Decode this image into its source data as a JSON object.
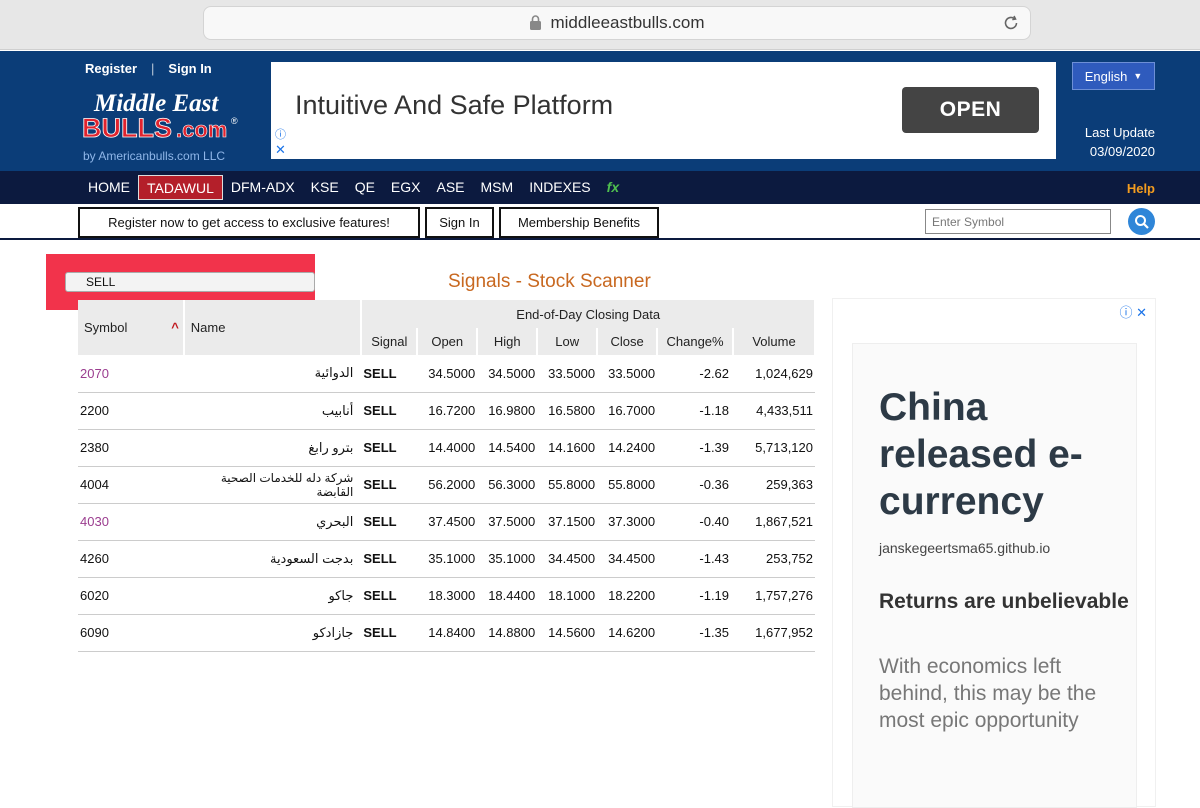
{
  "browser": {
    "url": "middleeastbulls.com"
  },
  "header": {
    "register": "Register",
    "sign_in": "Sign In",
    "logo_line1": "Middle East",
    "logo_line2": "BULLS.com",
    "logo_tagline": "by Americanbulls.com LLC",
    "language": "English",
    "last_update_label": "Last Update",
    "last_update_date": "03/09/2020"
  },
  "ad_banner": {
    "text": "Intuitive And Safe Platform",
    "button": "OPEN"
  },
  "nav": {
    "items": [
      "HOME",
      "TADAWUL",
      "DFM-ADX",
      "KSE",
      "QE",
      "EGX",
      "ASE",
      "MSM",
      "INDEXES",
      "fx"
    ],
    "active": "TADAWUL",
    "help": "Help"
  },
  "subbar": {
    "register_promo": "Register now to get access to exclusive features!",
    "sign_in": "Sign In",
    "membership": "Membership Benefits",
    "symbol_placeholder": "Enter Symbol"
  },
  "filter": {
    "selected": "SELL"
  },
  "page_title": "Signals - Stock Scanner",
  "table": {
    "group_header": "End-of-Day Closing Data",
    "headers": {
      "symbol": "Symbol",
      "name": "Name",
      "signal": "Signal",
      "open": "Open",
      "high": "High",
      "low": "Low",
      "close": "Close",
      "change": "Change%",
      "volume": "Volume"
    },
    "rows": [
      {
        "symbol": "2070",
        "name": "الدوائية",
        "signal": "SELL",
        "open": "34.5000",
        "high": "34.5000",
        "low": "33.5000",
        "close": "33.5000",
        "change": "-2.62",
        "volume": "1,024,629"
      },
      {
        "symbol": "2200",
        "name": "أنابيب",
        "signal": "SELL",
        "open": "16.7200",
        "high": "16.9800",
        "low": "16.5800",
        "close": "16.7000",
        "change": "-1.18",
        "volume": "4,433,511"
      },
      {
        "symbol": "2380",
        "name": "بترو رابغ",
        "signal": "SELL",
        "open": "14.4000",
        "high": "14.5400",
        "low": "14.1600",
        "close": "14.2400",
        "change": "-1.39",
        "volume": "5,713,120"
      },
      {
        "symbol": "4004",
        "name": "شركة دله للخدمات الصحية القابضة",
        "signal": "SELL",
        "open": "56.2000",
        "high": "56.3000",
        "low": "55.8000",
        "close": "55.8000",
        "change": "-0.36",
        "volume": "259,363"
      },
      {
        "symbol": "4030",
        "name": "البحري",
        "signal": "SELL",
        "open": "37.4500",
        "high": "37.5000",
        "low": "37.1500",
        "close": "37.3000",
        "change": "-0.40",
        "volume": "1,867,521"
      },
      {
        "symbol": "4260",
        "name": "بدجت السعودية",
        "signal": "SELL",
        "open": "35.1000",
        "high": "35.1000",
        "low": "34.4500",
        "close": "34.4500",
        "change": "-1.43",
        "volume": "253,752"
      },
      {
        "symbol": "6020",
        "name": "جاكو",
        "signal": "SELL",
        "open": "18.3000",
        "high": "18.4400",
        "low": "18.1000",
        "close": "18.2200",
        "change": "-1.19",
        "volume": "1,757,276"
      },
      {
        "symbol": "6090",
        "name": "جازادكو",
        "signal": "SELL",
        "open": "14.8400",
        "high": "14.8800",
        "low": "14.5600",
        "close": "14.6200",
        "change": "-1.35",
        "volume": "1,677,952"
      }
    ]
  },
  "side_ad": {
    "headline": "China released e-currency",
    "domain": "janskegeertsma65.github.io",
    "subheadline": "Returns are unbelievable",
    "body": "With economics left behind, this may be the most epic opportunity"
  },
  "colors": {
    "header_bg": "#0b3d78",
    "nav_bg": "#0c1a3f",
    "active_tab": "#b41f2a",
    "signal_red": "#d21c1c",
    "title_orange": "#c86820",
    "highlight": "#f2334b"
  }
}
